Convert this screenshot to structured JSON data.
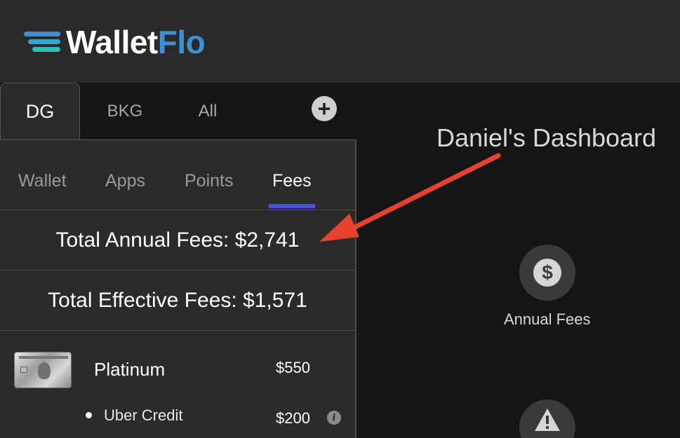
{
  "brand": {
    "name_part1": "Wallet",
    "name_part2": "Flo",
    "accent": "#3d8fd6"
  },
  "profile_tabs": [
    {
      "label": "DG",
      "active": true
    },
    {
      "label": "BKG",
      "active": false
    },
    {
      "label": "All",
      "active": false
    }
  ],
  "add_profile_label": "+",
  "subtabs": [
    {
      "label": "Wallet",
      "active": false
    },
    {
      "label": "Apps",
      "active": false
    },
    {
      "label": "Points",
      "active": false
    },
    {
      "label": "Fees",
      "active": true
    }
  ],
  "totals": {
    "annual": "Total Annual Fees: $2,741",
    "effective": "Total Effective Fees: $1,571"
  },
  "cards": [
    {
      "name": "Platinum",
      "fee": "$550",
      "credits": [
        {
          "name": "Uber Credit",
          "value": "$200",
          "info": "i"
        }
      ]
    }
  ],
  "dashboard": {
    "title": "Daniel's Dashboard",
    "annual_fees_label": "Annual Fees",
    "dollar_symbol": "$",
    "warning_symbol": "!"
  },
  "colors": {
    "header_bg": "#2a2a2a",
    "page_bg": "#151515",
    "panel_bg": "#2b2b2b",
    "tab_underline": "#4a4ee8",
    "annotation_arrow": "#e8412c"
  }
}
